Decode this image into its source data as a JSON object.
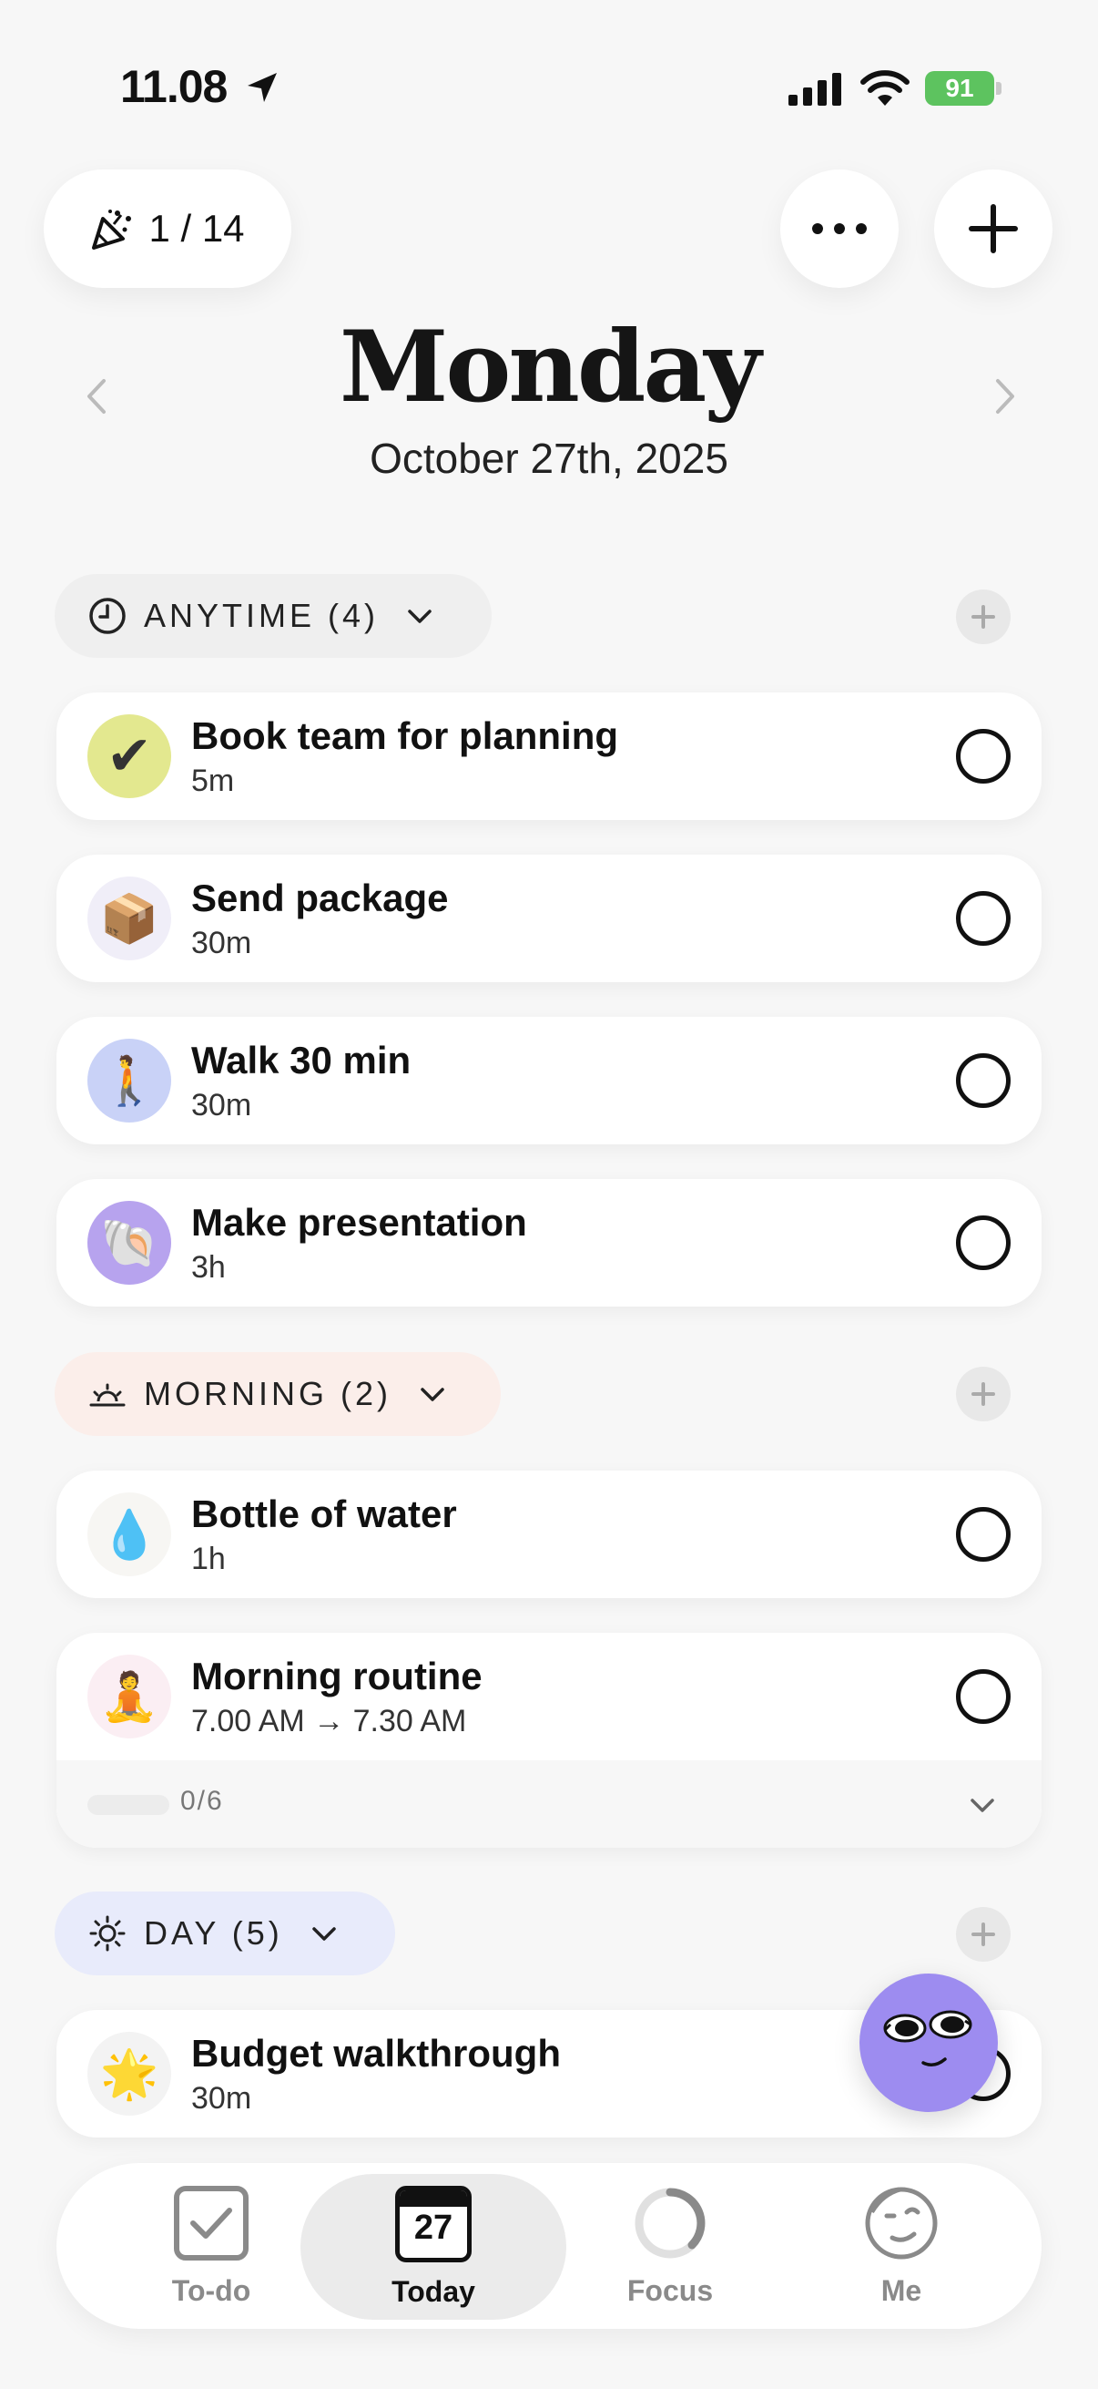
{
  "status": {
    "time": "11.08",
    "battery": "91"
  },
  "header": {
    "counter": "1 / 14",
    "day": "Monday",
    "date": "October 27th, 2025"
  },
  "sections": {
    "anytime": {
      "label": "ANYTIME (4)"
    },
    "morning": {
      "label": "MORNING (2)"
    },
    "day": {
      "label": "DAY (5)"
    }
  },
  "tasks": [
    {
      "title": "Book team for planning",
      "sub": "5m",
      "icon": "✔",
      "icon_name": "check-mark-icon",
      "icon_bg": "#e3e88f"
    },
    {
      "title": "Send package",
      "sub": "30m",
      "icon": "📦",
      "icon_name": "package-icon",
      "icon_bg": "#f0eef8"
    },
    {
      "title": "Walk 30 min",
      "sub": "30m",
      "icon": "🚶",
      "icon_name": "walking-person-icon",
      "icon_bg": "#c9d2f7"
    },
    {
      "title": "Make presentation",
      "sub": "3h",
      "icon": "🐚",
      "icon_name": "shell-icon",
      "icon_bg": "#b7a3ee"
    },
    {
      "title": "Bottle of water",
      "sub": "1h",
      "icon": "💧",
      "icon_name": "water-drop-icon",
      "icon_bg": "#f7f6f3"
    },
    {
      "title": "Morning routine",
      "sub": "7.00 AM → 7.30 AM",
      "icon": "🧘",
      "icon_name": "meditation-icon",
      "icon_bg": "#fbeef3",
      "subtasks": "0/6"
    },
    {
      "title": "Budget walkthrough",
      "sub": "30m",
      "icon": "🌟",
      "icon_name": "star-icon",
      "icon_bg": "#f3f3f3"
    }
  ],
  "nav": {
    "todo": "To-do",
    "today": "Today",
    "today_day": "27",
    "focus": "Focus",
    "me": "Me"
  },
  "colors": {
    "anytime_pill": "#efefef",
    "morning_pill": "#fbeeea",
    "day_pill": "#e8ebfb",
    "avatar": "#9d8cf0",
    "battery": "#5dc35f"
  }
}
